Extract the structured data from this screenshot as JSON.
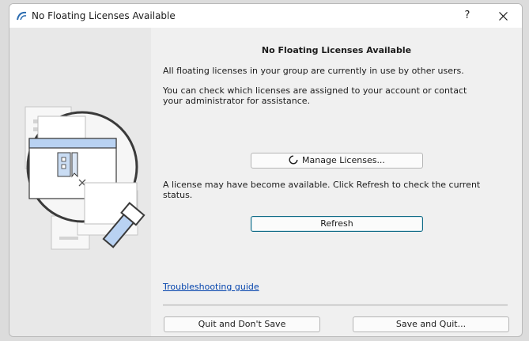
{
  "window": {
    "title": "No Floating Licenses Available",
    "help_label": "?"
  },
  "content": {
    "heading": "No Floating Licenses Available",
    "paragraph1": "All floating licenses in your group are currently in use by other users.",
    "paragraph2": "You can check which licenses are assigned to your account or contact your administrator for assistance.",
    "manage_button": "Manage Licenses...",
    "paragraph3": "A license may have become available. Click Refresh to check the current status.",
    "refresh_button": "Refresh",
    "troubleshooting_link": "Troubleshooting guide",
    "quit_button": "Quit and Don't Save",
    "save_quit_button": "Save and Quit..."
  },
  "colors": {
    "accent": "#0f6a86",
    "link": "#0645ad",
    "illustration_highlight": "#b9d2f2"
  },
  "icons": [
    "app-icon",
    "help-icon",
    "close-icon",
    "spinner-icon",
    "magnifier-illustration"
  ]
}
